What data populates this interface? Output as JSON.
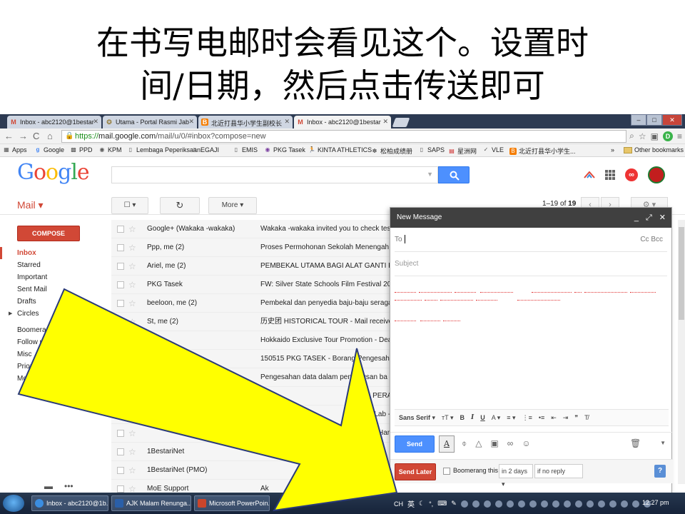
{
  "slide": {
    "title_line1": "在书写电邮时会看见这个。设置时",
    "title_line2": "间/日期，然后点击传送即可"
  },
  "browser": {
    "tabs": [
      {
        "label": "Inbox - abc2120@1bestar",
        "icon": "gmail-icon"
      },
      {
        "label": "Utama - Portal Rasmi Jab",
        "icon": "crest-icon"
      },
      {
        "label": "北近打县华小学生副校长",
        "icon": "blogger-icon"
      },
      {
        "label": "Inbox - abc2120@1bestar",
        "icon": "gmail-icon"
      }
    ],
    "url_scheme": "https://",
    "url_host": "mail.google.com",
    "url_path": "/mail/u/0/#inbox?compose=new",
    "bookmarks": [
      "Apps",
      "Google",
      "PPD",
      "KPM",
      "Lembaga Peperiksaan",
      "EGAJI",
      "EMIS",
      "PKG Tasek",
      "KINTA ATHLETICS",
      "松柏成绩册",
      "SAPS",
      "星洲网",
      "VLE",
      "北近打县华小学生..."
    ],
    "bookmarks_overflow": "»",
    "other_bookmarks": "Other bookmarks"
  },
  "gmail": {
    "logo": {
      "letters": [
        "G",
        "o",
        "o",
        "g",
        "l",
        "e"
      ],
      "colors": [
        "#4285f4",
        "#ea4335",
        "#fbbc05",
        "#4285f4",
        "#34a853",
        "#ea4335"
      ]
    },
    "mail_label": "Mail ▾",
    "more_label": "More ▾",
    "pager_text": "1–19",
    "pager_of": " of ",
    "pager_total": "19",
    "compose_label": "COMPOSE",
    "sidebar": [
      "Inbox",
      "Starred",
      "Important",
      "Sent Mail",
      "Drafts",
      "Circles",
      "Boomerang",
      "Follow up",
      "Misc",
      "Priority",
      "More"
    ],
    "rows": [
      {
        "sender": "Google+ (Wakaka -wakaka)",
        "subject": "Wakaka -wakaka invited you to check tes"
      },
      {
        "sender": "Ppp, me (2)",
        "subject": "Proses Permohonan Sekolah Menengah"
      },
      {
        "sender": "Ariel, me (2)",
        "subject": "PEMBEKAL UTAMA BAGI ALAT GANTI K"
      },
      {
        "sender": "PKG Tasek",
        "subject": "FW: Silver State Schools Film Festival 20"
      },
      {
        "sender": "beeloon, me (2)",
        "subject": "Pembekal dan penyedia baju-baju seraga"
      },
      {
        "sender": "St, me (2)",
        "subject": "历史团 HISTORICAL TOUR - Mail receive"
      },
      {
        "sender": "",
        "subject": "Hokkaido Exclusive Tour Promotion - Dea"
      },
      {
        "sender": "",
        "subject": "150515 PKG TASEK - Borang Pengesahan"
      },
      {
        "sender": "",
        "subject": "Pengesahan data dalam pengurusan ba"
      },
      {
        "sender": "",
        "subject": "SERI PERA"
      },
      {
        "sender": "",
        "subject": "e Lab -"
      },
      {
        "sender": "",
        "subject": "Har"
      },
      {
        "sender": "1BestariNet",
        "subject": ""
      },
      {
        "sender": "1BestariNet (PMO)",
        "subject": ""
      },
      {
        "sender": "MoE Support",
        "subject": "Ak"
      }
    ]
  },
  "compose": {
    "title": "New Message",
    "to_label": "To",
    "cc_bcc": "Cc Bcc",
    "subject_placeholder": "Subject",
    "font_label": "Sans Serif ▾",
    "send_label": "Send",
    "send_later_label": "Send Later",
    "boomerang_label": "Boomerang this",
    "delay_value": "in 2 days",
    "condition_value": "if no reply"
  },
  "taskbar": {
    "items": [
      {
        "label": "Inbox - abc2120@1b...",
        "color": "#3b8de0"
      },
      {
        "label": "AJK Malam Renunga...",
        "color": "#2a5fa8"
      },
      {
        "label": "Microsoft PowerPoin...",
        "color": "#c9452b"
      }
    ],
    "lang": "CH",
    "ime": "英",
    "time": "12:27 pm"
  }
}
